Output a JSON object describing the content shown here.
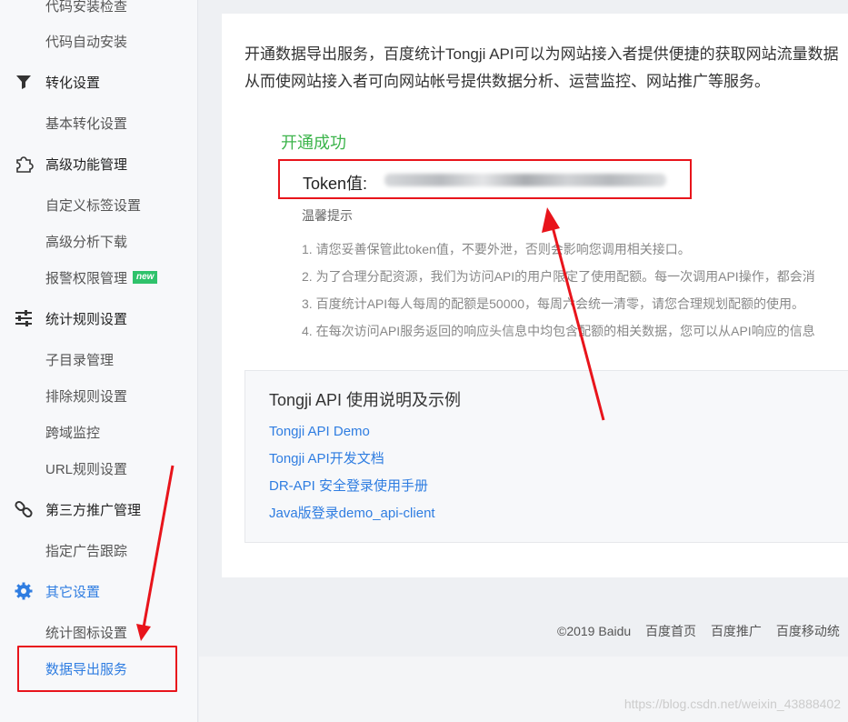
{
  "sidebar": {
    "top_items": [
      {
        "label": "代码安装检查"
      },
      {
        "label": "代码自动安装"
      }
    ],
    "groups": [
      {
        "label": "转化设置",
        "icon": "filter-icon",
        "items": [
          "基本转化设置"
        ]
      },
      {
        "label": "高级功能管理",
        "icon": "puzzle-icon",
        "items": [
          "自定义标签设置",
          "高级分析下载",
          "报警权限管理"
        ]
      },
      {
        "label": "统计规则设置",
        "icon": "sliders-icon",
        "items": [
          "子目录管理",
          "排除规则设置",
          "跨域监控",
          "URL规则设置"
        ]
      },
      {
        "label": "第三方推广管理",
        "icon": "link-icon",
        "items": [
          "指定广告跟踪"
        ]
      },
      {
        "label": "其它设置",
        "icon": "gear-icon",
        "items": [
          "统计图标设置",
          "数据导出服务"
        ]
      }
    ],
    "new_badge": "new"
  },
  "main": {
    "intro_line1": "开通数据导出服务，百度统计Tongji API可以为网站接入者提供便捷的获取网站流量数据",
    "intro_line2": "从而使网站接入者可向网站帐号提供数据分析、运营监控、网站推广等服务。",
    "success": "开通成功",
    "token_label": "Token值:",
    "tips_title": "温馨提示",
    "tips": [
      "1. 请您妥善保管此token值，不要外泄，否则会影响您调用相关接口。",
      "2. 为了合理分配资源，我们为访问API的用户限定了使用配额。每一次调用API操作，都会消",
      "3. 百度统计API每人每周的配额是50000，每周六会统一清零，请您合理规划配额的使用。",
      "4. 在每次访问API服务返回的响应头信息中均包含配额的相关数据，您可以从API响应的信息"
    ],
    "api_title": "Tongji API 使用说明及示例",
    "api_links": [
      "Tongji API Demo",
      "Tongji API开发文档",
      "DR-API 安全登录使用手册",
      "Java版登录demo_api-client"
    ]
  },
  "footer": [
    "©2019 Baidu",
    "百度首页",
    "百度推广",
    "百度移动统"
  ],
  "watermark": "https://blog.csdn.net/weixin_43888402",
  "colors": {
    "accent": "#2f7de1",
    "success": "#3cb44b",
    "highlight": "#e8141b",
    "badge": "#2fc26b"
  }
}
